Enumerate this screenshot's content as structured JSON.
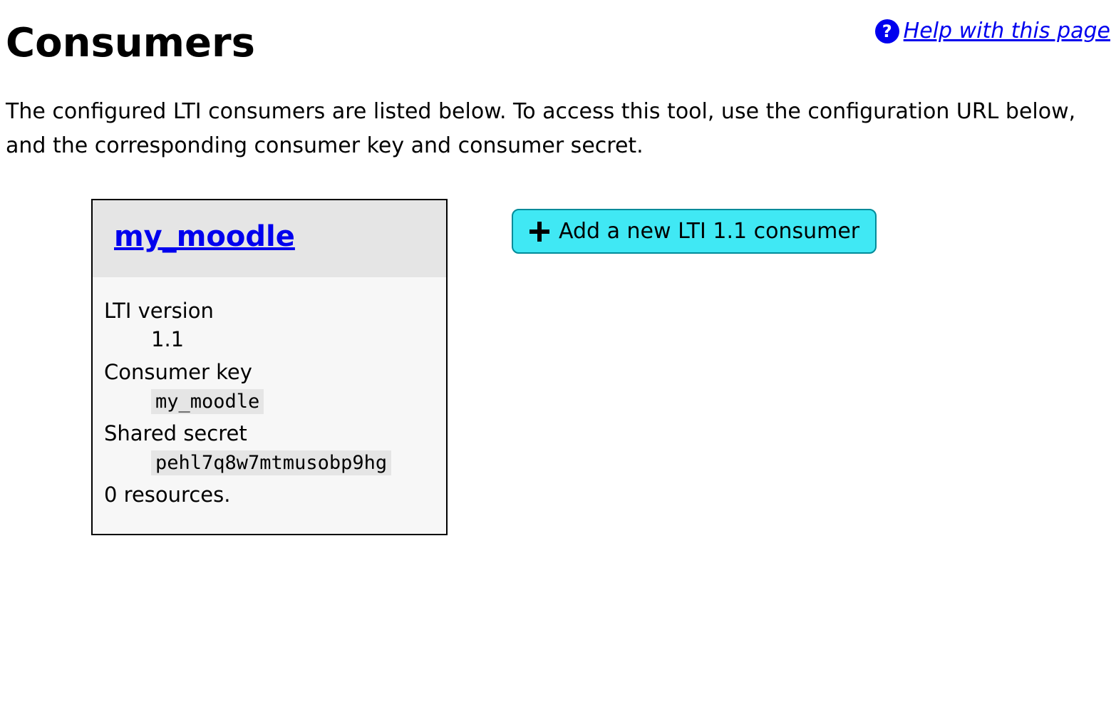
{
  "header": {
    "title": "Consumers",
    "help_link_text": " Help with this page"
  },
  "description": "The configured LTI consumers are listed below. To access this tool, use the configuration URL below, and the corresponding consumer key and consumer secret.",
  "consumer": {
    "name": "my_moodle",
    "lti_version_label": "LTI version",
    "lti_version_value": "1.1",
    "consumer_key_label": "Consumer key",
    "consumer_key_value": "my_moodle",
    "shared_secret_label": "Shared secret",
    "shared_secret_value": "pehl7q8w7mtmusobp9hg",
    "resources_text": "0 resources."
  },
  "actions": {
    "add_consumer_label": "Add a new LTI 1.1 consumer"
  }
}
